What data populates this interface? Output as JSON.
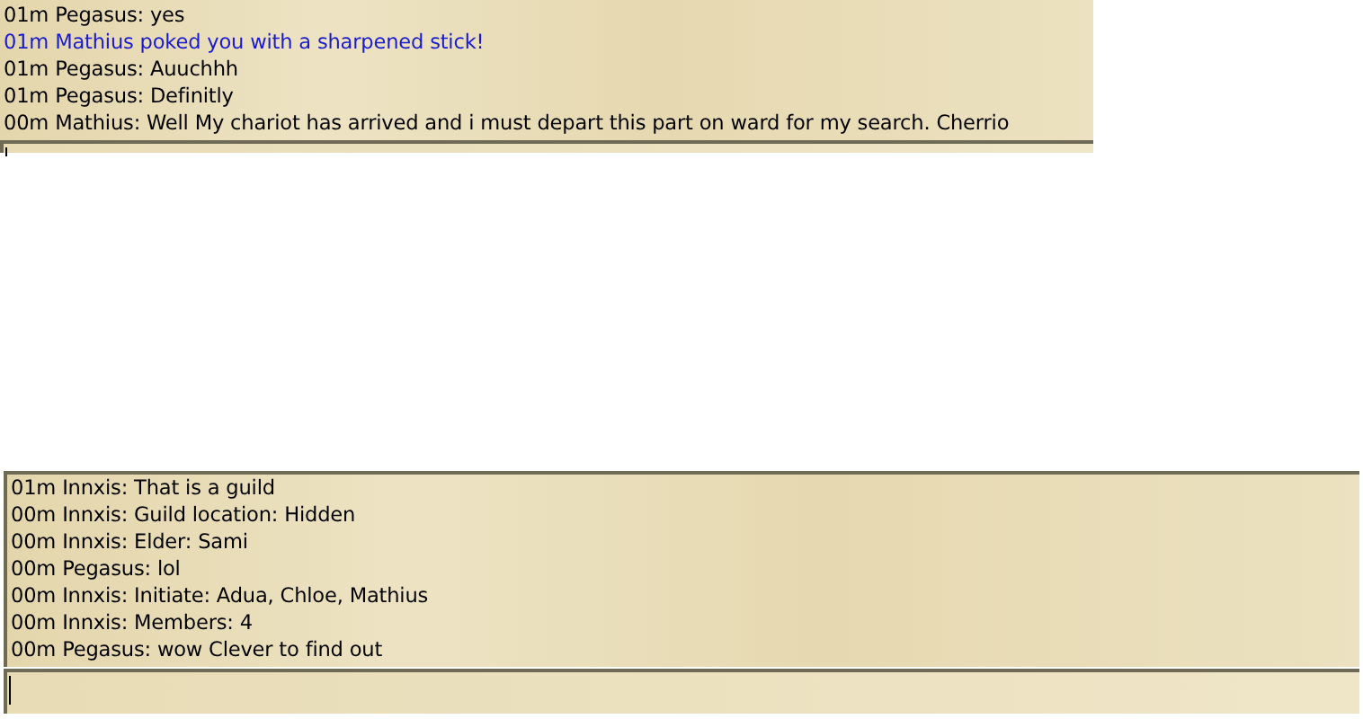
{
  "chat_panels": [
    {
      "messages": [
        {
          "kind": "say",
          "text": "01m Pegasus: yes"
        },
        {
          "kind": "emote",
          "text": "01m Mathius poked you with a sharpened stick!"
        },
        {
          "kind": "say",
          "text": "01m Pegasus: Auuchhh"
        },
        {
          "kind": "say",
          "text": "01m Pegasus: Definitly"
        },
        {
          "kind": "say",
          "text": "00m Mathius: Well My chariot has arrived and i must depart this part on ward for my search. Cherrio"
        }
      ]
    },
    {
      "messages": [
        {
          "kind": "say",
          "text": "01m Innxis: That is a guild"
        },
        {
          "kind": "say",
          "text": "00m Innxis: Guild location: Hidden"
        },
        {
          "kind": "say",
          "text": "00m Innxis: Elder: Sami"
        },
        {
          "kind": "say",
          "text": "00m Pegasus: lol"
        },
        {
          "kind": "say",
          "text": "00m Innxis: Initiate: Adua, Chloe, Mathius"
        },
        {
          "kind": "say",
          "text": "00m Innxis: Members: 4"
        },
        {
          "kind": "say",
          "text": "00m Pegasus: wow Clever to find out"
        }
      ]
    }
  ]
}
